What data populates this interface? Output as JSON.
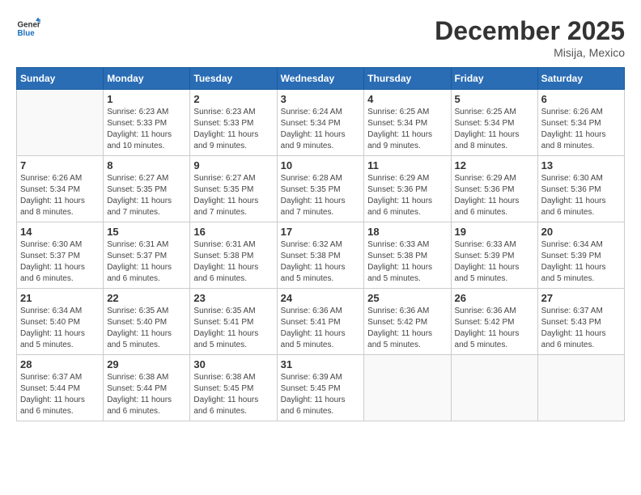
{
  "header": {
    "logo_general": "General",
    "logo_blue": "Blue",
    "month_title": "December 2025",
    "location": "Misija, Mexico"
  },
  "weekdays": [
    "Sunday",
    "Monday",
    "Tuesday",
    "Wednesday",
    "Thursday",
    "Friday",
    "Saturday"
  ],
  "weeks": [
    [
      {
        "day": "",
        "info": ""
      },
      {
        "day": "1",
        "info": "Sunrise: 6:23 AM\nSunset: 5:33 PM\nDaylight: 11 hours\nand 10 minutes."
      },
      {
        "day": "2",
        "info": "Sunrise: 6:23 AM\nSunset: 5:33 PM\nDaylight: 11 hours\nand 9 minutes."
      },
      {
        "day": "3",
        "info": "Sunrise: 6:24 AM\nSunset: 5:34 PM\nDaylight: 11 hours\nand 9 minutes."
      },
      {
        "day": "4",
        "info": "Sunrise: 6:25 AM\nSunset: 5:34 PM\nDaylight: 11 hours\nand 9 minutes."
      },
      {
        "day": "5",
        "info": "Sunrise: 6:25 AM\nSunset: 5:34 PM\nDaylight: 11 hours\nand 8 minutes."
      },
      {
        "day": "6",
        "info": "Sunrise: 6:26 AM\nSunset: 5:34 PM\nDaylight: 11 hours\nand 8 minutes."
      }
    ],
    [
      {
        "day": "7",
        "info": "Sunrise: 6:26 AM\nSunset: 5:34 PM\nDaylight: 11 hours\nand 8 minutes."
      },
      {
        "day": "8",
        "info": "Sunrise: 6:27 AM\nSunset: 5:35 PM\nDaylight: 11 hours\nand 7 minutes."
      },
      {
        "day": "9",
        "info": "Sunrise: 6:27 AM\nSunset: 5:35 PM\nDaylight: 11 hours\nand 7 minutes."
      },
      {
        "day": "10",
        "info": "Sunrise: 6:28 AM\nSunset: 5:35 PM\nDaylight: 11 hours\nand 7 minutes."
      },
      {
        "day": "11",
        "info": "Sunrise: 6:29 AM\nSunset: 5:36 PM\nDaylight: 11 hours\nand 6 minutes."
      },
      {
        "day": "12",
        "info": "Sunrise: 6:29 AM\nSunset: 5:36 PM\nDaylight: 11 hours\nand 6 minutes."
      },
      {
        "day": "13",
        "info": "Sunrise: 6:30 AM\nSunset: 5:36 PM\nDaylight: 11 hours\nand 6 minutes."
      }
    ],
    [
      {
        "day": "14",
        "info": "Sunrise: 6:30 AM\nSunset: 5:37 PM\nDaylight: 11 hours\nand 6 minutes."
      },
      {
        "day": "15",
        "info": "Sunrise: 6:31 AM\nSunset: 5:37 PM\nDaylight: 11 hours\nand 6 minutes."
      },
      {
        "day": "16",
        "info": "Sunrise: 6:31 AM\nSunset: 5:38 PM\nDaylight: 11 hours\nand 6 minutes."
      },
      {
        "day": "17",
        "info": "Sunrise: 6:32 AM\nSunset: 5:38 PM\nDaylight: 11 hours\nand 5 minutes."
      },
      {
        "day": "18",
        "info": "Sunrise: 6:33 AM\nSunset: 5:38 PM\nDaylight: 11 hours\nand 5 minutes."
      },
      {
        "day": "19",
        "info": "Sunrise: 6:33 AM\nSunset: 5:39 PM\nDaylight: 11 hours\nand 5 minutes."
      },
      {
        "day": "20",
        "info": "Sunrise: 6:34 AM\nSunset: 5:39 PM\nDaylight: 11 hours\nand 5 minutes."
      }
    ],
    [
      {
        "day": "21",
        "info": "Sunrise: 6:34 AM\nSunset: 5:40 PM\nDaylight: 11 hours\nand 5 minutes."
      },
      {
        "day": "22",
        "info": "Sunrise: 6:35 AM\nSunset: 5:40 PM\nDaylight: 11 hours\nand 5 minutes."
      },
      {
        "day": "23",
        "info": "Sunrise: 6:35 AM\nSunset: 5:41 PM\nDaylight: 11 hours\nand 5 minutes."
      },
      {
        "day": "24",
        "info": "Sunrise: 6:36 AM\nSunset: 5:41 PM\nDaylight: 11 hours\nand 5 minutes."
      },
      {
        "day": "25",
        "info": "Sunrise: 6:36 AM\nSunset: 5:42 PM\nDaylight: 11 hours\nand 5 minutes."
      },
      {
        "day": "26",
        "info": "Sunrise: 6:36 AM\nSunset: 5:42 PM\nDaylight: 11 hours\nand 5 minutes."
      },
      {
        "day": "27",
        "info": "Sunrise: 6:37 AM\nSunset: 5:43 PM\nDaylight: 11 hours\nand 6 minutes."
      }
    ],
    [
      {
        "day": "28",
        "info": "Sunrise: 6:37 AM\nSunset: 5:44 PM\nDaylight: 11 hours\nand 6 minutes."
      },
      {
        "day": "29",
        "info": "Sunrise: 6:38 AM\nSunset: 5:44 PM\nDaylight: 11 hours\nand 6 minutes."
      },
      {
        "day": "30",
        "info": "Sunrise: 6:38 AM\nSunset: 5:45 PM\nDaylight: 11 hours\nand 6 minutes."
      },
      {
        "day": "31",
        "info": "Sunrise: 6:39 AM\nSunset: 5:45 PM\nDaylight: 11 hours\nand 6 minutes."
      },
      {
        "day": "",
        "info": ""
      },
      {
        "day": "",
        "info": ""
      },
      {
        "day": "",
        "info": ""
      }
    ]
  ]
}
